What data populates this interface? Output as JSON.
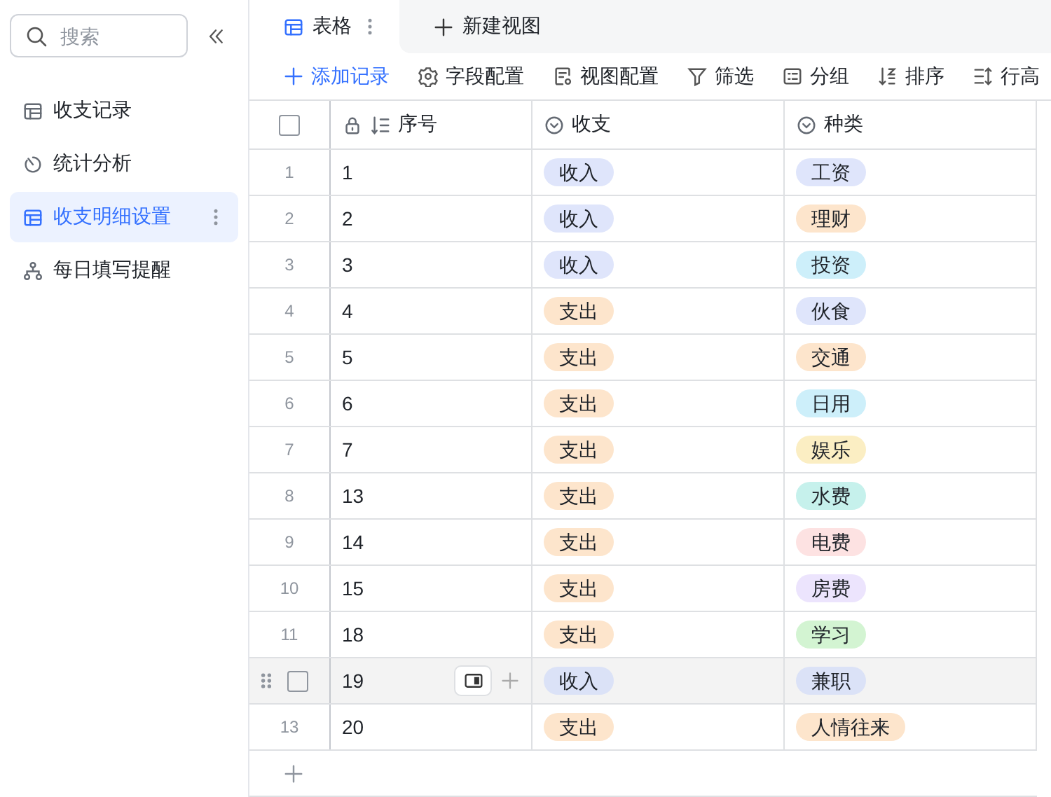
{
  "sidebar": {
    "search": {
      "placeholder": "搜索"
    },
    "items": [
      {
        "label": "收支记录",
        "selected": false
      },
      {
        "label": "统计分析",
        "selected": false
      },
      {
        "label": "收支明细设置",
        "selected": true
      },
      {
        "label": "每日填写提醒",
        "selected": false
      }
    ]
  },
  "tabs": [
    {
      "label": "表格",
      "selected": true
    },
    {
      "label": "新建视图",
      "selected": false
    }
  ],
  "toolbar": [
    {
      "label": "添加记录"
    },
    {
      "label": "字段配置"
    },
    {
      "label": "视图配置"
    },
    {
      "label": "筛选"
    },
    {
      "label": "分组"
    },
    {
      "label": "排序"
    },
    {
      "label": "行高"
    }
  ],
  "table": {
    "select_all": {
      "checked": false
    },
    "columns": [
      {
        "label": "序号"
      },
      {
        "label": "收支"
      },
      {
        "label": "种类"
      }
    ],
    "rows": [
      {
        "index": "1",
        "seq": "1",
        "type": {
          "label": "收入",
          "color": "#dfe5fb"
        },
        "category": {
          "label": "工资",
          "color": "#dfe5fb"
        },
        "hovered": false,
        "checked": false
      },
      {
        "index": "2",
        "seq": "2",
        "type": {
          "label": "收入",
          "color": "#dfe5fb"
        },
        "category": {
          "label": "理财",
          "color": "#fde5cc"
        },
        "hovered": false,
        "checked": false
      },
      {
        "index": "3",
        "seq": "3",
        "type": {
          "label": "收入",
          "color": "#dfe5fb"
        },
        "category": {
          "label": "投资",
          "color": "#cdeffa"
        },
        "hovered": false,
        "checked": false
      },
      {
        "index": "4",
        "seq": "4",
        "type": {
          "label": "支出",
          "color": "#fde5cc"
        },
        "category": {
          "label": "伙食",
          "color": "#dfe5fb"
        },
        "hovered": false,
        "checked": false
      },
      {
        "index": "5",
        "seq": "5",
        "type": {
          "label": "支出",
          "color": "#fde5cc"
        },
        "category": {
          "label": "交通",
          "color": "#fde5cc"
        },
        "hovered": false,
        "checked": false
      },
      {
        "index": "6",
        "seq": "6",
        "type": {
          "label": "支出",
          "color": "#fde5cc"
        },
        "category": {
          "label": "日用",
          "color": "#cdeffa"
        },
        "hovered": false,
        "checked": false
      },
      {
        "index": "7",
        "seq": "7",
        "type": {
          "label": "支出",
          "color": "#fde5cc"
        },
        "category": {
          "label": "娱乐",
          "color": "#fbeec3"
        },
        "hovered": false,
        "checked": false
      },
      {
        "index": "8",
        "seq": "13",
        "type": {
          "label": "支出",
          "color": "#fde5cc"
        },
        "category": {
          "label": "水费",
          "color": "#c6f1ec"
        },
        "hovered": false,
        "checked": false
      },
      {
        "index": "9",
        "seq": "14",
        "type": {
          "label": "支出",
          "color": "#fde5cc"
        },
        "category": {
          "label": "电费",
          "color": "#fde2e2"
        },
        "hovered": false,
        "checked": false
      },
      {
        "index": "10",
        "seq": "15",
        "type": {
          "label": "支出",
          "color": "#fde5cc"
        },
        "category": {
          "label": "房费",
          "color": "#ece4fd"
        },
        "hovered": false,
        "checked": false
      },
      {
        "index": "11",
        "seq": "18",
        "type": {
          "label": "支出",
          "color": "#fde5cc"
        },
        "category": {
          "label": "学习",
          "color": "#d3f4d2"
        },
        "hovered": false,
        "checked": false
      },
      {
        "seq": "19",
        "type": {
          "label": "收入",
          "color": "#dbe2f7"
        },
        "category": {
          "label": "兼职",
          "color": "#dbe2f7"
        },
        "hovered": true,
        "checked": false
      },
      {
        "index": "13",
        "seq": "20",
        "type": {
          "label": "支出",
          "color": "#fde5cc"
        },
        "category": {
          "label": "人情往来",
          "color": "#fde5cc"
        },
        "hovered": false,
        "checked": false
      }
    ]
  }
}
